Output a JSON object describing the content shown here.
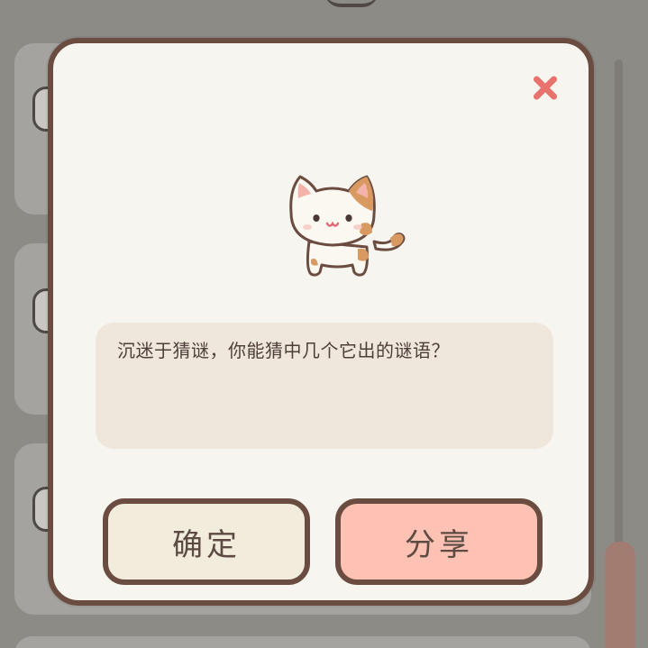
{
  "dialog": {
    "message": "沉迷于猜谜，你能猜中几个它出的谜语？",
    "confirm_label": "确定",
    "share_label": "分享",
    "close_icon": "close-icon",
    "illustration": "calico-cat"
  },
  "colors": {
    "modal_background": "#f7f5ef",
    "modal_border": "#6b4c40",
    "close_icon": "#e8736e",
    "message_background": "#f0e7dc",
    "confirm_background": "#f1ecdc",
    "share_background": "#fdc2b4",
    "overlay": "#8d8b86"
  }
}
